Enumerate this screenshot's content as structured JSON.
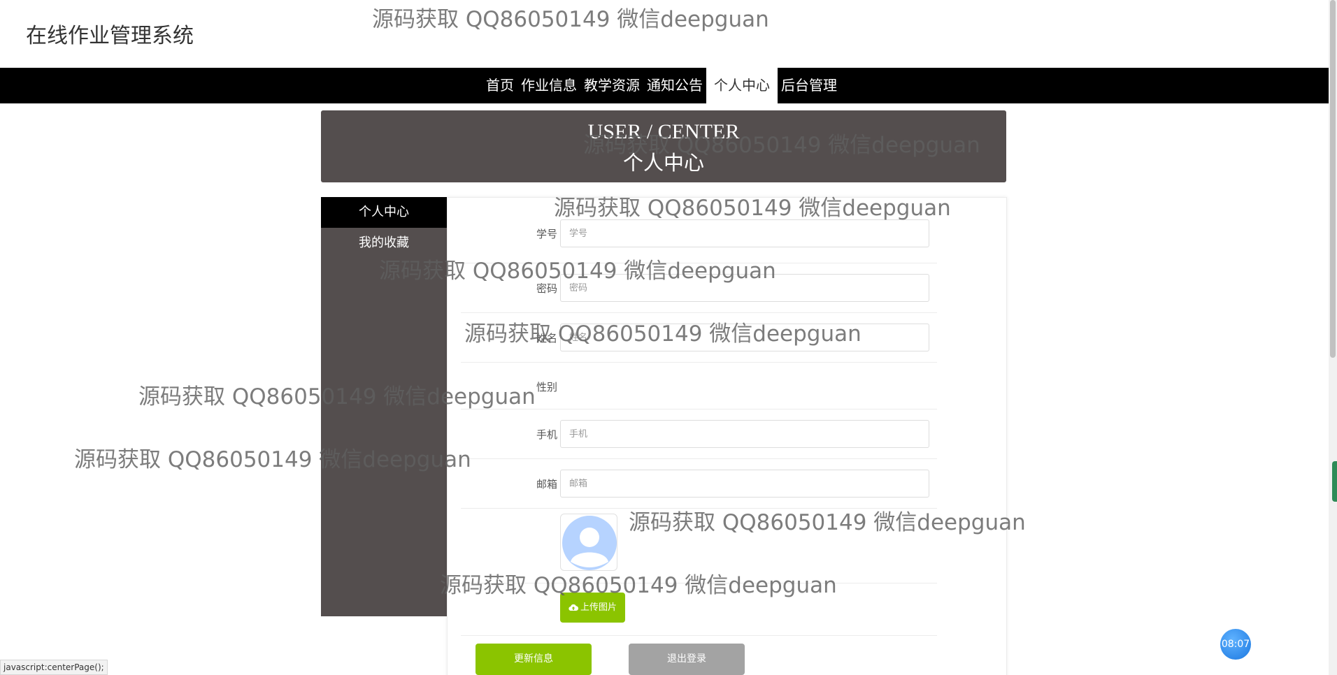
{
  "site": {
    "title": "在线作业管理系统"
  },
  "nav": {
    "items": [
      {
        "label": "首页"
      },
      {
        "label": "作业信息"
      },
      {
        "label": "教学资源"
      },
      {
        "label": "通知公告"
      },
      {
        "label": "个人中心",
        "active": true
      },
      {
        "label": "后台管理"
      }
    ]
  },
  "banner": {
    "title_en": "USER / CENTER",
    "title_zh": "个人中心"
  },
  "sidebar": {
    "items": [
      {
        "label": "个人中心",
        "active": true
      },
      {
        "label": "我的收藏"
      }
    ]
  },
  "form": {
    "fields": [
      {
        "label": "学号",
        "placeholder": "学号",
        "value": ""
      },
      {
        "label": "密码",
        "placeholder": "密码",
        "value": ""
      },
      {
        "label": "姓名",
        "placeholder": "姓名",
        "value": ""
      },
      {
        "label": "性别",
        "value": ""
      },
      {
        "label": "手机",
        "placeholder": "手机",
        "value": ""
      },
      {
        "label": "邮箱",
        "placeholder": "邮箱",
        "value": ""
      }
    ],
    "upload_label": "上传图片",
    "update_label": "更新信息",
    "logout_label": "退出登录"
  },
  "watermark": {
    "text": "源码获取 QQ86050149 微信deepguan"
  },
  "status_bar": {
    "link": "javascript:centerPage();"
  },
  "clock": {
    "time": "08:07"
  },
  "colors": {
    "nav_bg": "#000000",
    "banner_bg": "#544e4e",
    "accent_green": "#8bc400",
    "logout_gray": "#a3a3a3"
  }
}
